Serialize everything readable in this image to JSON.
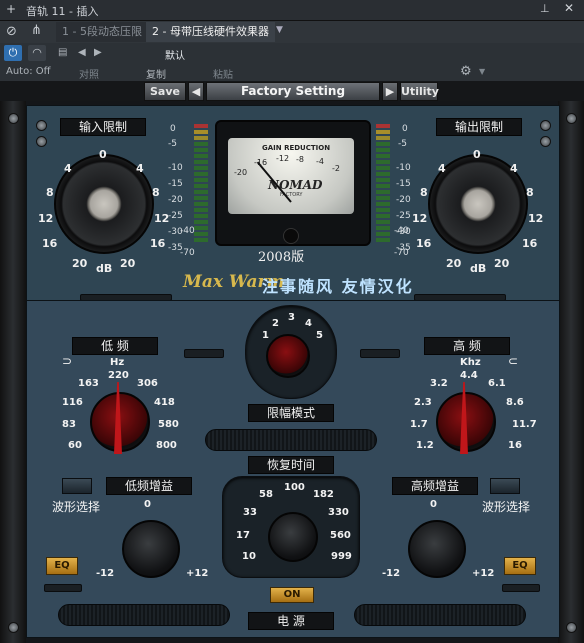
{
  "host": {
    "title": "音轨 11 - 插入",
    "tabs": [
      "1 - 5段动态压限",
      "2 - 母带压线硬件效果器"
    ],
    "preset_name": "默认",
    "auto_state": "Auto: Off",
    "actions": {
      "compare": "对照",
      "copy": "复制",
      "paste": "粘贴"
    }
  },
  "plugin": {
    "toolbar": {
      "save": "Save",
      "preset": "Factory Setting",
      "utility": "Utility"
    },
    "input_label": "输入限制",
    "output_label": "输出限制",
    "big_knob_ticks": [
      "0",
      "4",
      "8",
      "12",
      "16",
      "20",
      "4",
      "8",
      "12",
      "16",
      "20"
    ],
    "db": "dB",
    "vu_scale": [
      "0",
      "-5",
      "-10",
      "-15",
      "-20",
      "-25",
      "-30",
      "-35",
      "-40",
      "-50",
      "-70"
    ],
    "meter": {
      "title": "GAIN REDUCTION",
      "brand": "NOMAD",
      "sub": "FACTORY",
      "edition": "2008版",
      "scale": [
        "-20",
        "-16",
        "-12",
        "-8",
        "-4",
        "-2",
        "0"
      ]
    },
    "credit_brand": "Max Warm",
    "credit_text": "注事随风 友情汉化",
    "low_label": "低 频",
    "high_label": "高 频",
    "low_unit": "Hz",
    "high_unit": "Khz",
    "low_freqs": [
      "60",
      "83",
      "116",
      "163",
      "220",
      "306",
      "418",
      "580",
      "800"
    ],
    "high_freqs": [
      "1.2",
      "1.7",
      "2.3",
      "3.2",
      "4.4",
      "6.1",
      "8.6",
      "11.7",
      "16"
    ],
    "mode_numbers": [
      "1",
      "2",
      "3",
      "4",
      "5"
    ],
    "limit_mode": "限幅模式",
    "recovery": "恢复时间",
    "recovery_values": [
      "10",
      "17",
      "33",
      "58",
      "100",
      "182",
      "330",
      "560",
      "999"
    ],
    "low_gain": "低频增益",
    "high_gain": "高频增益",
    "wave_select": "波形选择",
    "gain_ticks": {
      "min": "-12",
      "mid": "0",
      "max": "+12"
    },
    "eq": "EQ",
    "on": "ON",
    "power": "电 源"
  }
}
